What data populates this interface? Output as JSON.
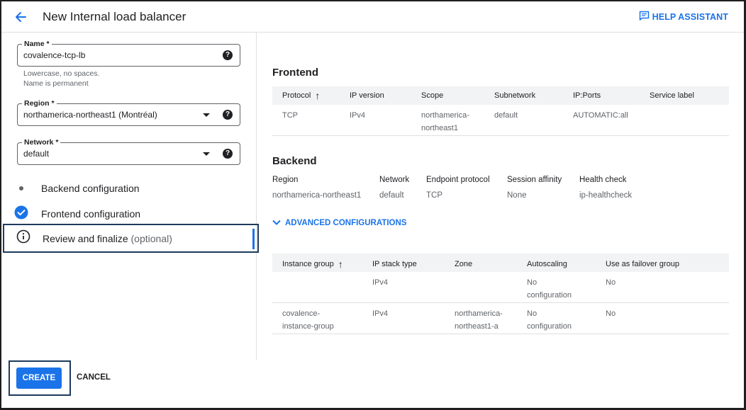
{
  "header": {
    "title": "New Internal load balancer",
    "help_label": "HELP ASSISTANT"
  },
  "form": {
    "name": {
      "label": "Name *",
      "value": "covalence-tcp-lb",
      "hint1": "Lowercase, no spaces.",
      "hint2": "Name is permanent"
    },
    "region": {
      "label": "Region *",
      "value": "northamerica-northeast1 (Montréal)"
    },
    "network": {
      "label": "Network *",
      "value": "default"
    }
  },
  "steps": [
    {
      "label": "Backend configuration"
    },
    {
      "label": "Frontend configuration"
    },
    {
      "label": "Review and finalize",
      "optional": "(optional)"
    }
  ],
  "frontend": {
    "title": "Frontend",
    "columns": [
      "Protocol",
      "IP version",
      "Scope",
      "Subnetwork",
      "IP:Ports",
      "Service label"
    ],
    "row": {
      "protocol": "TCP",
      "ip_version": "IPv4",
      "scope_line1": "northamerica-",
      "scope_line2": "northeast1",
      "subnetwork": "default",
      "ip_ports": "AUTOMATIC:all",
      "service_label": ""
    }
  },
  "backend": {
    "title": "Backend",
    "labels": [
      "Region",
      "Network",
      "Endpoint protocol",
      "Session affinity",
      "Health check"
    ],
    "values": [
      "northamerica-northeast1",
      "default",
      "TCP",
      "None",
      "ip-healthcheck"
    ],
    "advanced_label": "ADVANCED CONFIGURATIONS"
  },
  "instance_groups": {
    "columns": [
      "Instance group",
      "IP stack type",
      "Zone",
      "Autoscaling",
      "Use as failover group"
    ],
    "rows": [
      {
        "group_line1": "",
        "group_line2": "",
        "ip_stack": "IPv4",
        "zone_line1": "",
        "zone_line2": "",
        "autoscaling_line1": "No",
        "autoscaling_line2": "configuration",
        "failover": "No"
      },
      {
        "group_line1": "covalence-",
        "group_line2": "instance-group",
        "ip_stack": "IPv4",
        "zone_line1": "northamerica-",
        "zone_line2": "northeast1-a",
        "autoscaling_line1": "No",
        "autoscaling_line2": "configuration",
        "failover": "No"
      }
    ]
  },
  "actions": {
    "create": "CREATE",
    "cancel": "CANCEL"
  },
  "colors": {
    "accent": "#1a73e8",
    "highlight_border": "#1d3a5c"
  }
}
